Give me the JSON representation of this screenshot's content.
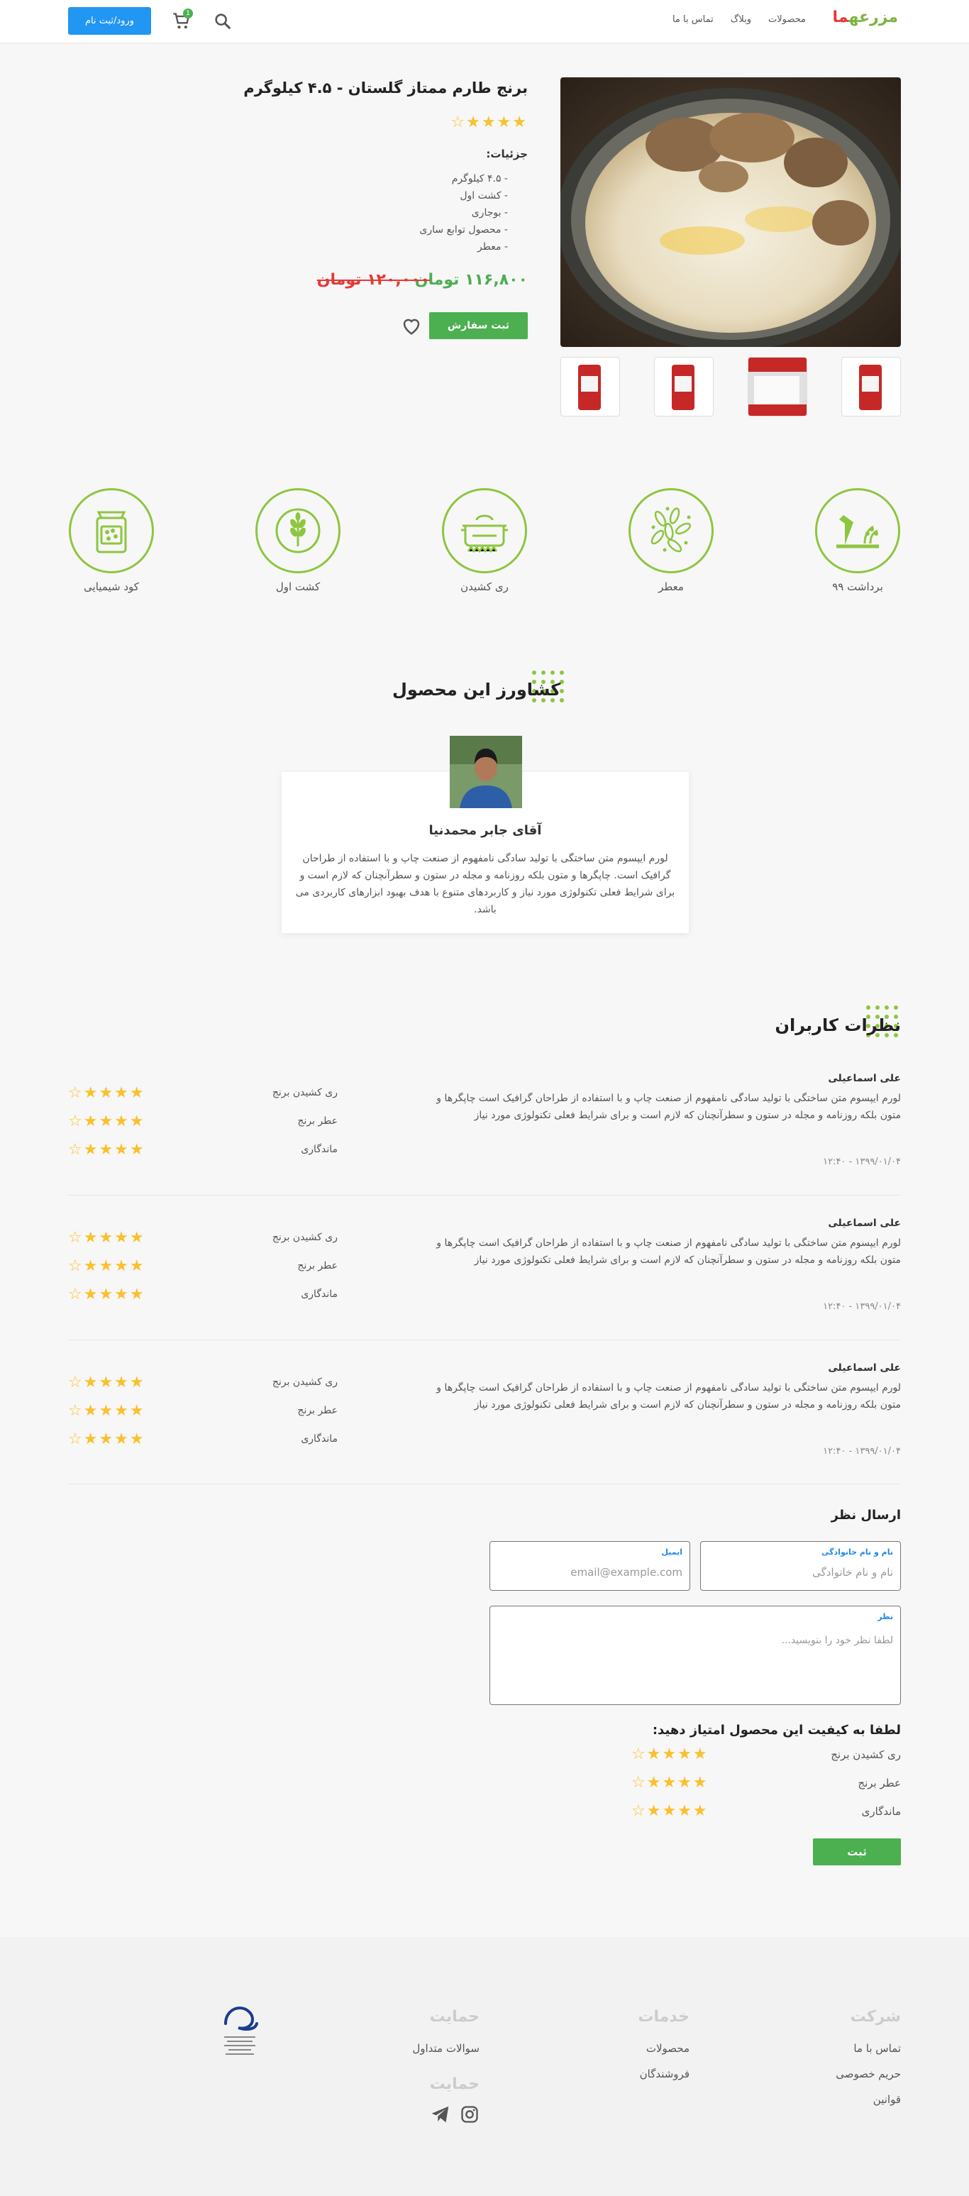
{
  "header": {
    "logo_main": "مزرعه",
    "logo_accent": "ما",
    "nav": [
      "محصولات",
      "وبلاگ",
      "تماس با ما"
    ],
    "login_label": "ورود/ثبت نام",
    "cart_count": "1"
  },
  "product": {
    "title": "برنج طارم ممتاز گلستان - ۴.۵ کیلوگرم",
    "rating": "★★★★☆",
    "details_label": "جزئیات:",
    "details": [
      "- ۴.۵ کیلوگرم",
      "- کشت اول",
      "- بوجاری",
      "- محصول توابع ساری",
      "- معطر"
    ],
    "price_new": "۱۱۶,۸۰۰ تومان",
    "price_old": "۱۲۰,۰۰۰ تومان",
    "order_label": "ثبت سفارش"
  },
  "features": [
    "برداشت ۹۹",
    "معطر",
    "ری کشیدن",
    "کشت اول",
    "کود شیمیایی"
  ],
  "farmer": {
    "section_title": "کشاورز این محصول",
    "name": "آقای جابر محمدنیا",
    "bio": "لورم ایپسوم متن ساختگی با تولید سادگی نامفهوم از صنعت چاپ و با استفاده از طراحان گرافیک است. چاپگرها و متون بلکه روزنامه و مجله در ستون و سطرآنچنان که لازم است و برای شرایط فعلی تکنولوژی مورد نیاز و کاربردهای متنوع با هدف بهبود ابزارهای کاربردی می باشد."
  },
  "reviews": {
    "section_title": "نظرات کاربران",
    "items": [
      {
        "name": "علی اسماعیلی",
        "text": "لورم ایپسوم متن ساختگی با تولید سادگی نامفهوم از صنعت چاپ و با استفاده از طراحان گرافیک است چاپگرها و متون بلکه روزنامه و مجله در ستون و سطرآنچنان که لازم است و برای شرایط فعلی تکنولوژی مورد نیاز",
        "date": "۱۳۹۹/۰۱/۰۴ - ۱۲:۴۰",
        "criteria": [
          {
            "label": "ری کشیدن برنج",
            "stars": "★★★★☆"
          },
          {
            "label": "عطر برنج",
            "stars": "★★★★☆"
          },
          {
            "label": "ماندگاری",
            "stars": "★★★★☆"
          }
        ]
      },
      {
        "name": "علی اسماعیلی",
        "text": "لورم ایپسوم متن ساختگی با تولید سادگی نامفهوم از صنعت چاپ و با استفاده از طراحان گرافیک است چاپگرها و متون بلکه روزنامه و مجله در ستون و سطرآنچنان که لازم است و برای شرایط فعلی تکنولوژی مورد نیاز",
        "date": "۱۳۹۹/۰۱/۰۴ - ۱۲:۴۰",
        "criteria": [
          {
            "label": "ری کشیدن برنج",
            "stars": "★★★★☆"
          },
          {
            "label": "عطر برنج",
            "stars": "★★★★☆"
          },
          {
            "label": "ماندگاری",
            "stars": "★★★★☆"
          }
        ]
      },
      {
        "name": "علی اسماعیلی",
        "text": "لورم ایپسوم متن ساختگی با تولید سادگی نامفهوم از صنعت چاپ و با استفاده از طراحان گرافیک است چاپگرها و متون بلکه روزنامه و مجله در ستون و سطرآنچنان که لازم است و برای شرایط فعلی تکنولوژی مورد نیاز",
        "date": "۱۳۹۹/۰۱/۰۴ - ۱۲:۴۰",
        "criteria": [
          {
            "label": "ری کشیدن برنج",
            "stars": "★★★★☆"
          },
          {
            "label": "عطر برنج",
            "stars": "★★★★☆"
          },
          {
            "label": "ماندگاری",
            "stars": "★★★★☆"
          }
        ]
      }
    ]
  },
  "comment_form": {
    "title": "ارسال نظر",
    "name_label": "نام و نام خانوادگی",
    "name_placeholder": "نام و نام خانوادگی",
    "email_label": "ایمیل",
    "email_placeholder": "email@example.com",
    "comment_label": "نظر",
    "comment_placeholder": "لطفا نظر خود را بنویسید...",
    "quality_title": "لطفا به کیفیت این محصول امتیاز دهید:",
    "criteria": [
      {
        "label": "ری کشیدن برنج",
        "stars": "★★★★☆"
      },
      {
        "label": "عطر برنج",
        "stars": "★★★★☆"
      },
      {
        "label": "ماندگاری",
        "stars": "★★★★☆"
      }
    ],
    "submit_label": "ثبت"
  },
  "footer": {
    "company_title": "شرکت",
    "company_links": [
      "تماس با ما",
      "حریم خصوصی",
      "قوانین"
    ],
    "services_title": "خدمات",
    "services_links": [
      "محصولات",
      "فروشندگان"
    ],
    "support_title": "حمایت",
    "support_links": [
      "سوالات متداول"
    ],
    "social_title": "حمایت"
  },
  "colors": {
    "primary_green": "#4caf50",
    "accent_green": "#8dc63f",
    "blue": "#2196f3",
    "star": "#fbc02d",
    "price_old": "#e53935"
  }
}
